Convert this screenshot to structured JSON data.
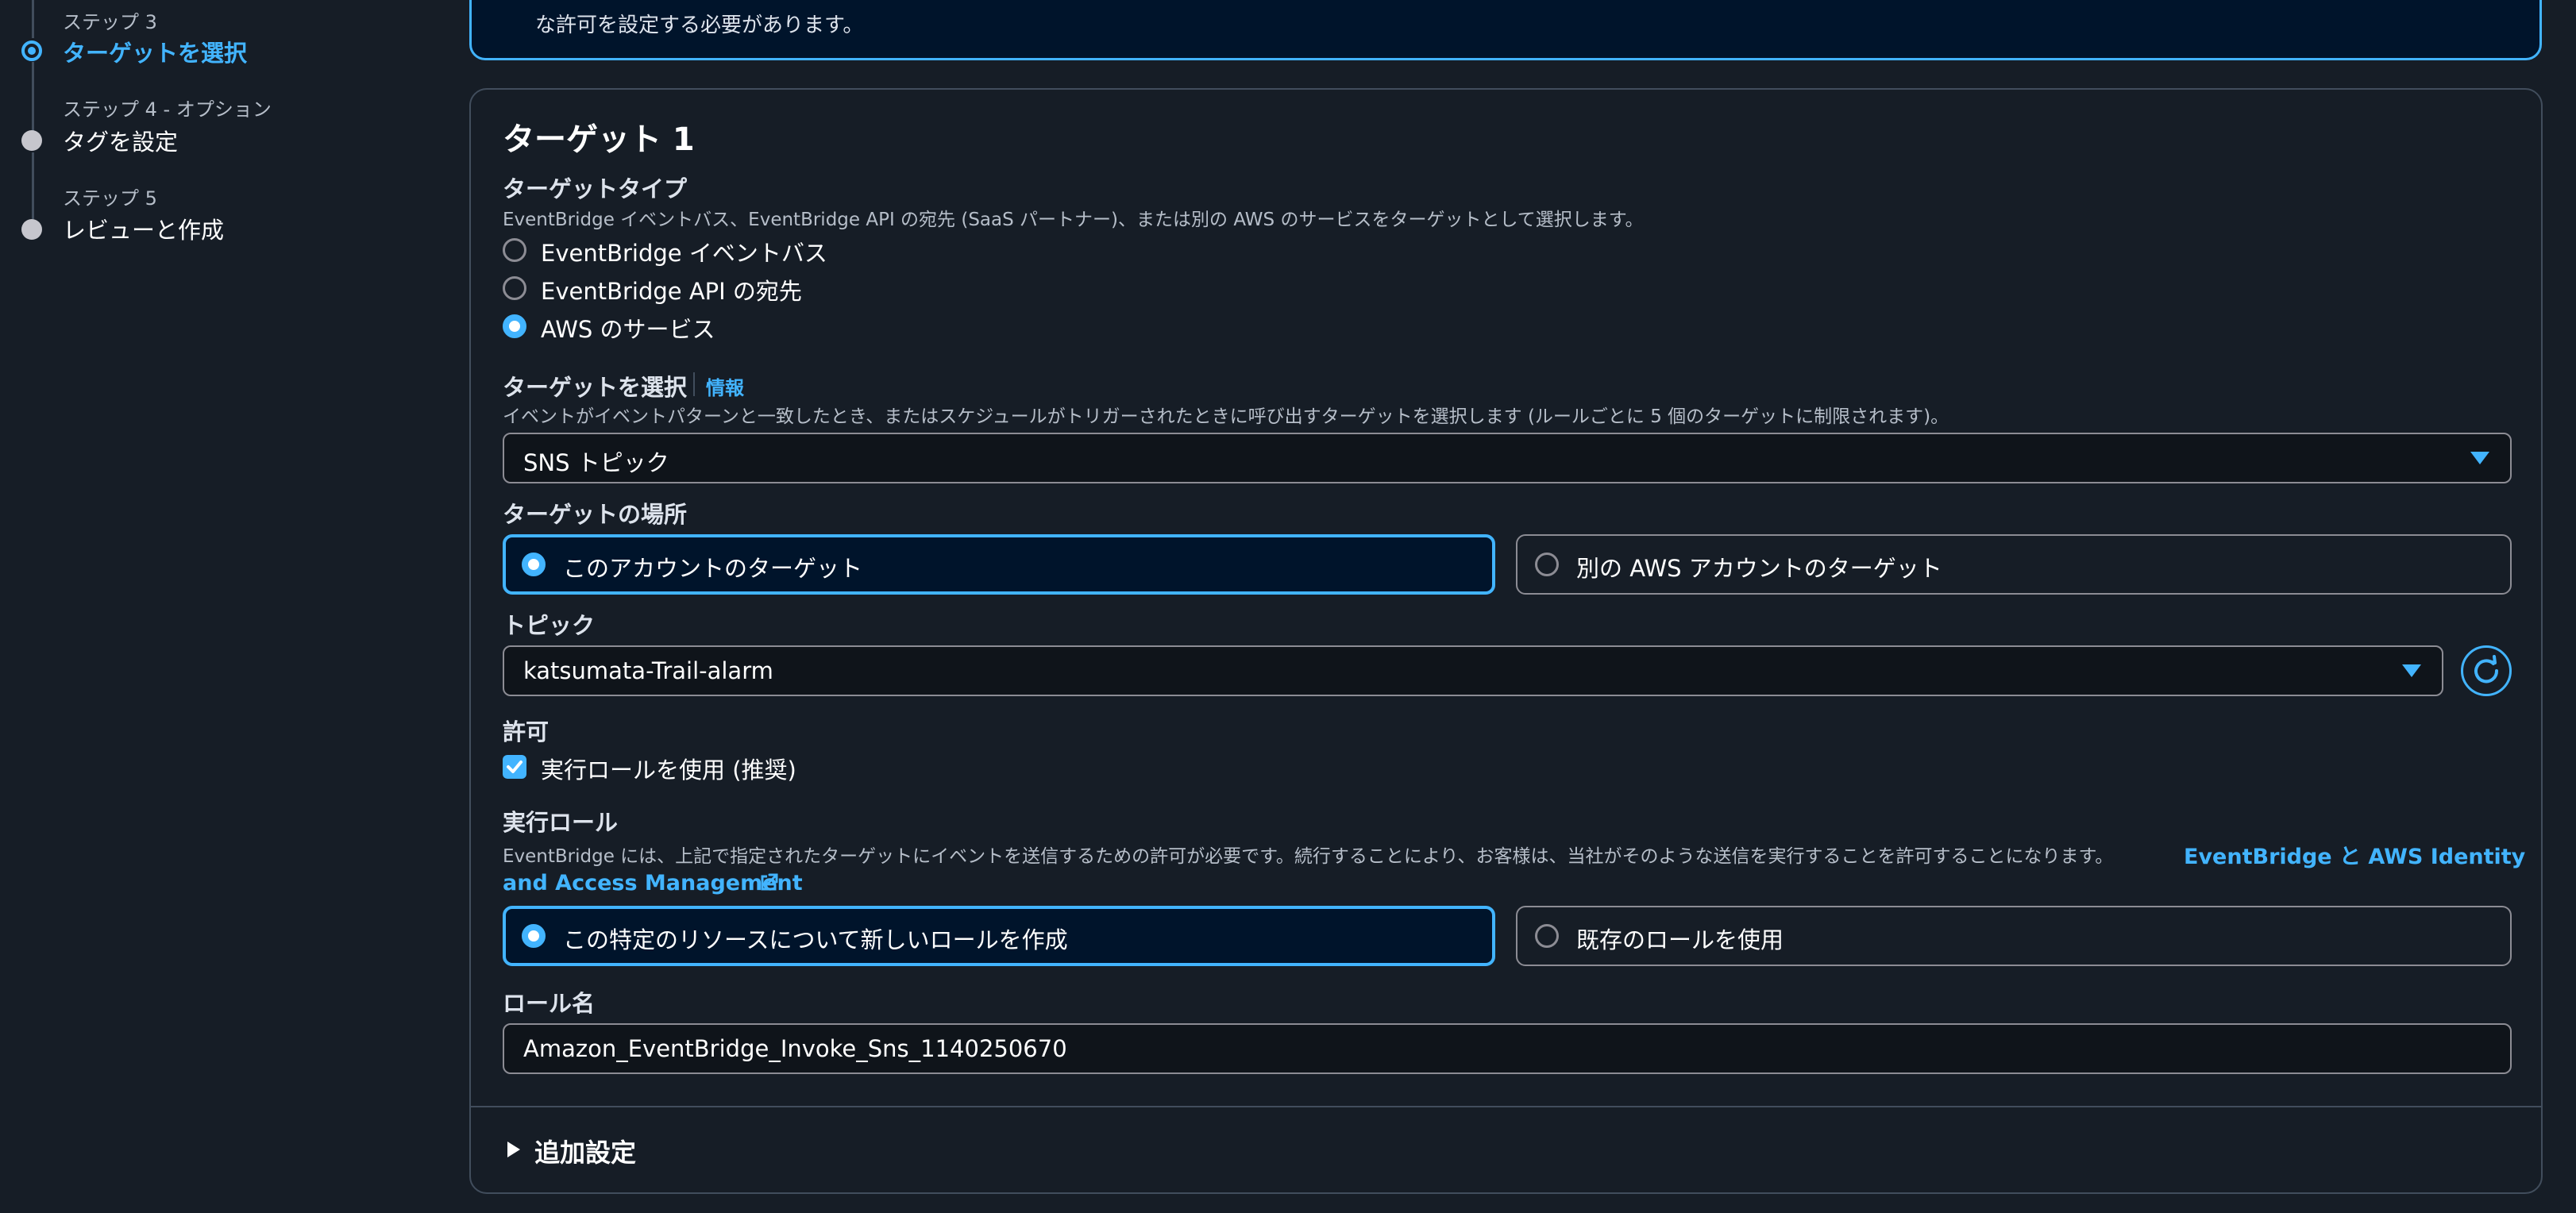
{
  "steps": [
    {
      "sub": "ステップ 3",
      "title": "ターゲットを選択",
      "state": "active"
    },
    {
      "sub": "ステップ 4 - オプション",
      "title": "タグを設定",
      "state": "pending"
    },
    {
      "sub": "ステップ 5",
      "title": "レビューと作成",
      "state": "pending"
    }
  ],
  "info_box": {
    "text": "な許可を設定する必要があります。"
  },
  "card": {
    "title": "ターゲット 1",
    "target_type": {
      "label": "ターゲットタイプ",
      "description": "EventBridge イベントバス、EventBridge API の宛先 (SaaS パートナー)、または別の AWS のサービスをターゲットとして選択します。",
      "options": [
        "EventBridge イベントバス",
        "EventBridge API の宛先",
        "AWS のサービス"
      ],
      "selected": "AWS のサービス"
    },
    "select_target": {
      "label": "ターゲットを選択",
      "info_link": "情報",
      "description": "イベントがイベントパターンと一致したとき、またはスケジュールがトリガーされたときに呼び出すターゲットを選択します (ルールごとに 5 個のターゲットに制限されます)。",
      "value": "SNS トピック"
    },
    "target_location": {
      "label": "ターゲットの場所",
      "options": [
        "このアカウントのターゲット",
        "別の AWS アカウントのターゲット"
      ],
      "selected": "このアカウントのターゲット"
    },
    "topic": {
      "label": "トピック",
      "value": "katsumata-Trail-alarm"
    },
    "permission": {
      "label": "許可",
      "checkbox_label": "実行ロールを使用 (推奨)",
      "checked": true
    },
    "execution_role": {
      "label": "実行ロール",
      "description": "EventBridge には、上記で指定されたターゲットにイベントを送信するための許可が必要です。続行することにより、お客様は、当社がそのような送信を実行することを許可することになります。",
      "link_line1": "EventBridge と AWS Identity",
      "link_line2": "and Access Management",
      "options": [
        "この特定のリソースについて新しいロールを作成",
        "既存のロールを使用"
      ],
      "selected": "この特定のリソースについて新しいロールを作成"
    },
    "role_name": {
      "label": "ロール名",
      "value": "Amazon_EventBridge_Invoke_Sns_1140250670"
    },
    "additional_settings": {
      "label": "追加設定"
    }
  },
  "colors": {
    "accent": "#42b4ff",
    "background": "#161d26",
    "selected_tile_bg": "#00142b"
  }
}
